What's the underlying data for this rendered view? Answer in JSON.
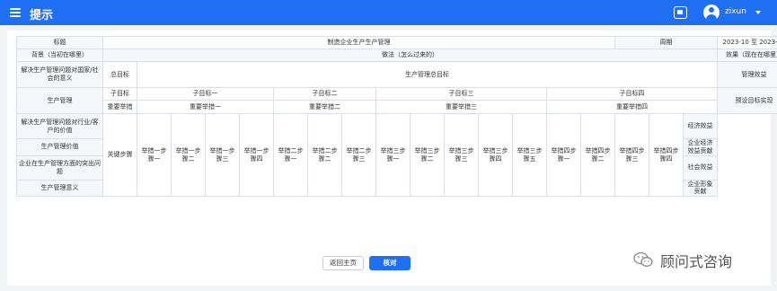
{
  "header": {
    "title": "提示",
    "username": "zixun"
  },
  "table": {
    "title_label": "标题",
    "title_value": "制造企业生产生产管理",
    "period_label": "周期",
    "period_value": "2023-10 至 2023-12",
    "background": "背景（当初在哪里）",
    "method": "做法（怎么过来的）",
    "effect": "效果（现在在哪里）",
    "significance_country": "解决生产管理问题对国家/社会的意义",
    "total_goal_label": "总目标",
    "total_goal_value": "生产管理总目标",
    "mgmt_benefit": "管理效益",
    "production_mgmt": "生产管理",
    "subgoal_label": "子目标",
    "subgoals": [
      "子目标一",
      "子目标二",
      "子目标三",
      "子目标四"
    ],
    "measures_label": "重要举措",
    "measures": [
      "重要举措一",
      "重要举措二",
      "重要举措三",
      "重要举措四"
    ],
    "preset_goal": "预设目标实现",
    "significance_industry": "解决生产管理问题对行业/客户的价值",
    "key_steps": "关键步骤",
    "steps": [
      "举措一步骤一",
      "举措一步骤二",
      "举措一步骤三",
      "举措一步骤四",
      "举措二步骤一",
      "举措二步骤二",
      "举措二步骤三",
      "举措三步骤一",
      "举措三步骤二",
      "举措三步骤三",
      "举措三步骤四",
      "举措三步骤五",
      "举措四步骤一",
      "举措四步骤二",
      "举措四步骤三",
      "举措四步骤四"
    ],
    "economic_benefit": "经济效益",
    "production_value": "生产管理价值",
    "enterprise_economic": "企业经济效益贡献",
    "outstanding_issue": "企业在生产管理方面的突出问题",
    "social_benefit": "社会效益",
    "production_significance": "生产管理意义",
    "image_contribution": "企业形象贡献"
  },
  "buttons": {
    "home": "返回主页",
    "check": "核对"
  },
  "watermark": {
    "text": "顾问式咨询"
  },
  "colors": {
    "primary": "#1f6ff2",
    "border": "#dcdfe6",
    "header_bg": "#f5f7fa"
  },
  "icons": {
    "menu": "menu-icon",
    "message": "message-icon",
    "user": "user-avatar-icon",
    "watermark": "wechat-icon"
  }
}
